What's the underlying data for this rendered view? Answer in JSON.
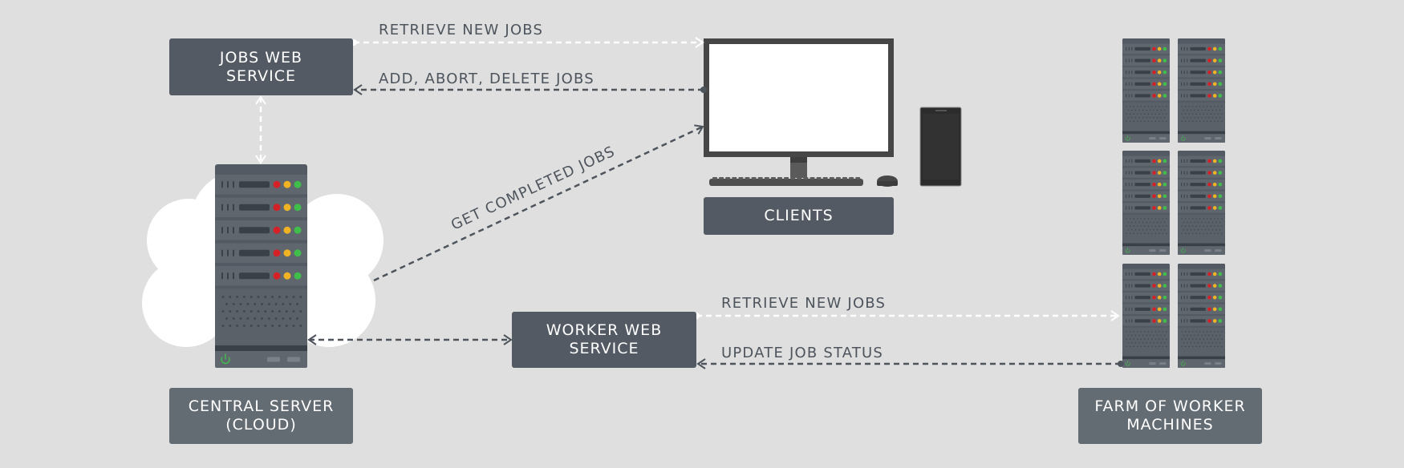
{
  "diagram": {
    "nodes": {
      "jobs_web_service": "JOBS WEB\nSERVICE",
      "worker_web_service": "WORKER WEB\nSERVICE",
      "clients": "CLIENTS",
      "central_server": "CENTRAL SERVER\n(CLOUD)",
      "farm": "FARM OF WORKER\nMACHINES"
    },
    "edges": {
      "jobs_to_clients": "RETRIEVE NEW JOBS",
      "clients_to_jobs": "ADD, ABORT, DELETE JOBS",
      "server_to_clients": "GET COMPLETED JOBS",
      "worker_to_farm": "RETRIEVE NEW JOBS",
      "farm_to_worker": "UPDATE JOB STATUS"
    },
    "farm_server_count": 6,
    "server_units": 5,
    "colors": {
      "background": "#dfdfdf",
      "box_dark": "#535a63",
      "box_light": "#636b73",
      "led_red": "#d32127",
      "led_yellow": "#f0b323",
      "led_green": "#3fbf4a",
      "arrow_dark": "#4d545c",
      "arrow_light": "#ffffff"
    }
  }
}
